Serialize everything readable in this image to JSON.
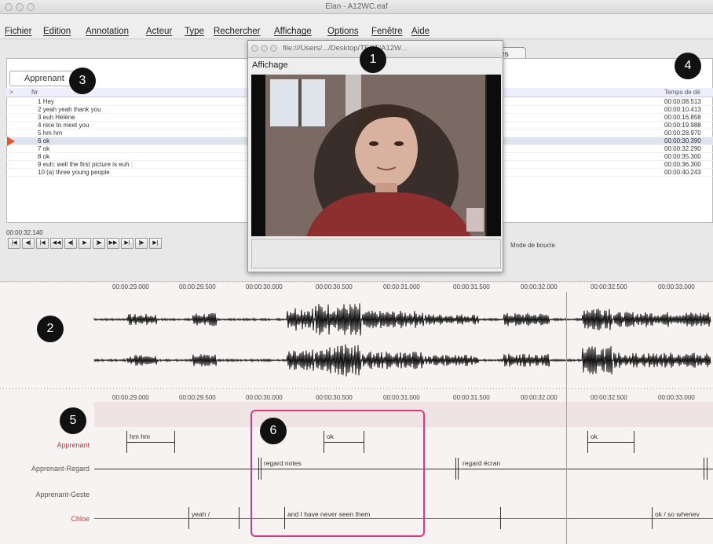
{
  "window": {
    "title": "Elan - A12WC.eaf"
  },
  "menu": [
    "Fichier",
    "Edition",
    "Annotation",
    "Acteur",
    "Type",
    "Rechercher",
    "Affichage",
    "Options",
    "Fenêtre",
    "Aide"
  ],
  "top": {
    "tier_select": "Apprenant",
    "col_nr": "Nr",
    "col_time": "Temps de dé",
    "rows": [
      {
        "n": "1",
        "text": "Hey",
        "time": "00:00:08.513"
      },
      {
        "n": "2",
        "text": "yeah yeah thank you",
        "time": "00:00:10.413"
      },
      {
        "n": "3",
        "text": "euh Hélène",
        "time": "00:00:16.858"
      },
      {
        "n": "4",
        "text": "nice to meet you",
        "time": "00:00:19.988"
      },
      {
        "n": "5",
        "text": "hm hm",
        "time": "00:00:28.970"
      },
      {
        "n": "6",
        "text": "ok",
        "time": "00:00:30.390"
      },
      {
        "n": "7",
        "text": "ok",
        "time": "00:00:32.290"
      },
      {
        "n": "8",
        "text": "ok",
        "time": "00:00:35.300"
      },
      {
        "n": "9",
        "text": "euh: well the first picture is euh :",
        "time": "00:00:36.300"
      },
      {
        "n": "10",
        "text": "(a) three young people",
        "time": "00:00:40.243"
      }
    ],
    "current_time": "00:00:32.140",
    "loop_label": "Mode de boucle",
    "partial_button": "les"
  },
  "video": {
    "path": "file:///Users/.../Desktop/TEST/A12W...",
    "label": "Affichage"
  },
  "ruler_ticks": [
    "00:00:29.000",
    "00:00:29.500",
    "00:00:30.000",
    "00:00:30.500",
    "00:00:31.000",
    "00:00:31.500",
    "00:00:32.000",
    "00:00:32.500",
    "00:00:33.000"
  ],
  "tiers": [
    {
      "name": "Apprenant",
      "color": "#c0392b"
    },
    {
      "name": "Apprenant-Regard",
      "color": "#555555"
    },
    {
      "name": "Apprenant-Geste",
      "color": "#555555"
    },
    {
      "name": "Chloe",
      "color": "#c0392b"
    }
  ],
  "annotations": {
    "apprenant": [
      "hm hm",
      "ok",
      "ok"
    ],
    "regard": [
      "regard notes",
      "regard écran"
    ],
    "chloe": [
      "yeah /",
      "and I have never seen them",
      "ok / so whenev"
    ]
  },
  "callouts": [
    "1",
    "2",
    "3",
    "4",
    "5",
    "6"
  ],
  "colors": {
    "highlight": "#e0367d",
    "cursor": "#e5888a",
    "play_marker": "#e0552a"
  }
}
